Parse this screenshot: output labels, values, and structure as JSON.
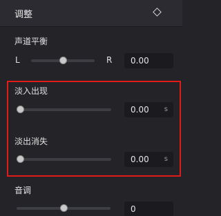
{
  "header": {
    "title": "调整"
  },
  "balance": {
    "label": "声道平衡",
    "left_label": "L",
    "right_label": "R",
    "value": "0.00"
  },
  "fade_in": {
    "label": "淡入出现",
    "value": "0.00",
    "unit": "s"
  },
  "fade_out": {
    "label": "淡出消失",
    "value": "0.00",
    "unit": "s"
  },
  "pitch": {
    "label": "音调",
    "value": "0"
  },
  "colors": {
    "highlight": "#e11a1a",
    "panel_bg": "#232328",
    "header_bg": "#2b2b31"
  }
}
